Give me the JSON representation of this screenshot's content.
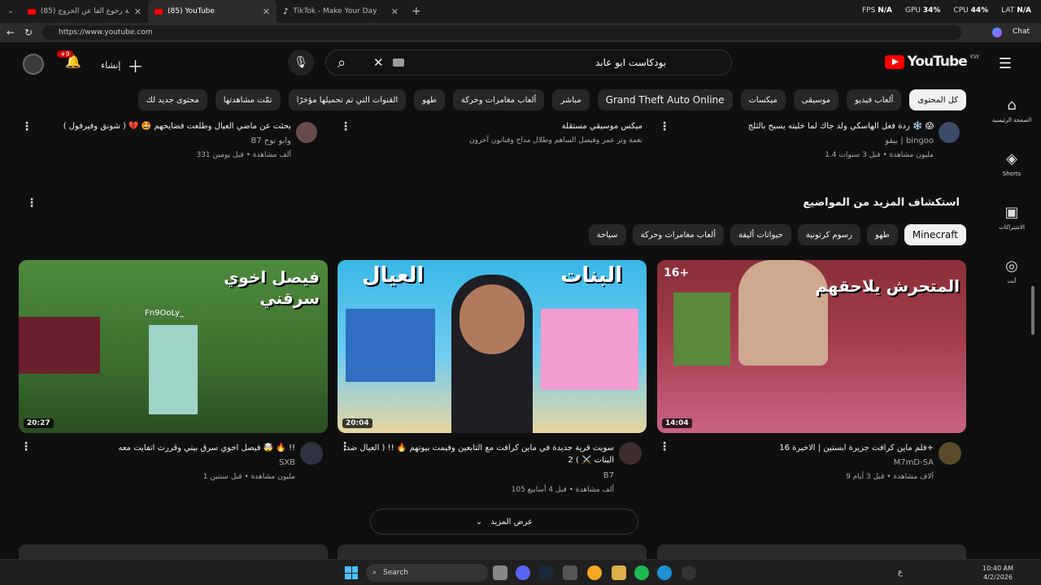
{
  "browser": {
    "tabs": [
      {
        "label": "(85) بث اسامة رجوع الفا عن الخروج ..."
      },
      {
        "label": "(85) YouTube"
      },
      {
        "label": "TikTok - Make Your Day"
      }
    ],
    "new_tab": "+",
    "url": "https://www.youtube.com",
    "perf": {
      "fps_label": "FPS",
      "fps": "N/A",
      "gpu_label": "GPU",
      "gpu": "34%",
      "cpu_label": "CPU",
      "cpu": "44%",
      "lat_label": "LAT",
      "lat": "N/A"
    },
    "chat_label": "Chat"
  },
  "youtube": {
    "logo": "YouTube",
    "region": "KW",
    "search_query": "بودكاست ابو عابد",
    "create_label": "إنشاء",
    "notif_count": "+9",
    "chips": [
      "كل المحتوى",
      "ألعاب فيديو",
      "موسيقى",
      "ميكسات",
      "Grand Theft Auto Online",
      "مباشر",
      "ألعاب مغامرات وحركة",
      "طهو",
      "القنوات التي تم تحميلها مؤخرًا",
      "تمّت مشاهدتها",
      "محتوى جديد لك"
    ],
    "sidebar": [
      {
        "icon": "home-icon",
        "label": "الصفحة الرئيسية"
      },
      {
        "icon": "shorts-icon",
        "label": "Shorts"
      },
      {
        "icon": "subscriptions-icon",
        "label": "الاشتراكات"
      },
      {
        "icon": "you-icon",
        "label": "أنت"
      }
    ],
    "top_row": [
      {
        "title": "ردة فعل الهاسكي ولد جاك لما خليته يسبح بالثلج ❄️ 😱",
        "channel": "بيقو | bingoo",
        "meta": "1.4 مليون مشاهدة • قبل 3 سنوات"
      },
      {
        "title": "ميكس موسيقي مستقلة",
        "channel": "نغمة وتر عمر وفيصل الساهم وطلال مداح وفنانون آخرون",
        "meta": ""
      },
      {
        "title": "بحثت عن ماضي العيال وطلعت فضايحهم 🤩 💔 ( شونق وفيرفول )",
        "channel": "B7 وابو نوح",
        "meta": "331 ألف مشاهدة • قبل يومين"
      }
    ],
    "explore_title": "استكشاف المزيد من المواضيع",
    "topics": [
      "Minecraft",
      "طهو",
      "رسوم كرتونية",
      "حيوانات أليفة",
      "ألعاب مغامرات وحركة",
      "سياحة"
    ],
    "videos": [
      {
        "title": "فلم ماين كرافت جزيرة ابستين | الاخيرة 16+",
        "channel": "M7mD-SA",
        "meta": "9 آلاف مشاهدة • قبل 3 أيام",
        "duration": "14:04",
        "thumb_text": "المتحرش يلاحقهم",
        "badge": "16+"
      },
      {
        "title": "سويت قرية جديدة في ماين كرافت مع التابعين وفيمت بيوتهم 🔥 !! ( العيال ضد البنات ⚔️ ) 2",
        "channel": "B7",
        "meta": "105 ألف مشاهدة • قبل 4 أسابيع",
        "duration": "20:04",
        "thumb_text_left": "العيال",
        "thumb_text_right": "البنات"
      },
      {
        "title": "فيصل اخوي سرق بيتي وقررت اتفايت معه 🤯 🔥 !!",
        "channel": "SXB",
        "meta": "1 مليون مشاهدة • قبل سنتين",
        "duration": "20:27",
        "thumb_text": "فيصل اخوي سرقني",
        "thumb_tag": "Fn9OoLy_"
      }
    ],
    "show_more": "عرض المزيد"
  },
  "taskbar": {
    "search_placeholder": "Search",
    "time": "10:40 AM",
    "date": "4/2/2026",
    "lang": "ع"
  }
}
